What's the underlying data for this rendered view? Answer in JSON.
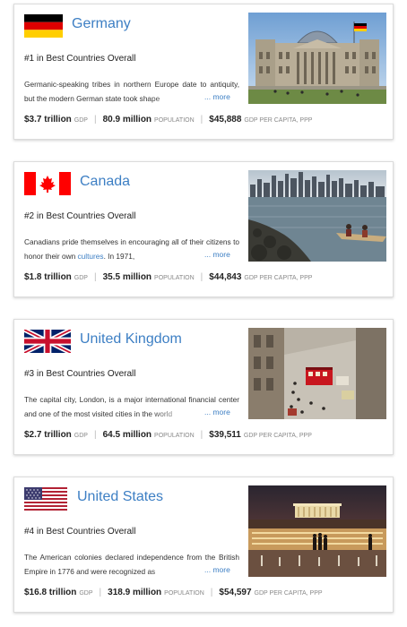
{
  "countries": [
    {
      "name": "Germany",
      "rank": "#1 in Best Countries Overall",
      "description": "Germanic-speaking tribes in northern Europe date to antiquity, but the modern German state took shape",
      "description_link": "",
      "more": "... more",
      "gdp": "$3.7 trillion",
      "gdp_label": "GDP",
      "population": "80.9 million",
      "population_label": "POPULATION",
      "gdp_per_capita": "$45,888",
      "gdp_per_capita_label": "GDP PER CAPITA, PPP"
    },
    {
      "name": "Canada",
      "rank": "#2 in Best Countries Overall",
      "description": "Canadians pride themselves in encouraging all of their citizens to honor their own ",
      "description_link": "cultures",
      "description_tail": ". In 1971,",
      "more": "... more",
      "gdp": "$1.8 trillion",
      "gdp_label": "GDP",
      "population": "35.5 million",
      "population_label": "POPULATION",
      "gdp_per_capita": "$44,843",
      "gdp_per_capita_label": "GDP PER CAPITA, PPP"
    },
    {
      "name": "United Kingdom",
      "rank": "#3 in Best Countries Overall",
      "description": "The capital city, London, is a major international financial center and one of the most visited cities in the world",
      "description_link": "",
      "more": "... more",
      "gdp": "$2.7 trillion",
      "gdp_label": "GDP",
      "population": "64.5 million",
      "population_label": "POPULATION",
      "gdp_per_capita": "$39,511",
      "gdp_per_capita_label": "GDP PER CAPITA, PPP"
    },
    {
      "name": "United States",
      "rank": "#4 in Best Countries Overall",
      "description": "The American colonies declared independence from the British Empire in 1776 and were recognized as",
      "description_link": "",
      "more": "... more",
      "gdp": "$16.8 trillion",
      "gdp_label": "GDP",
      "population": "318.9 million",
      "population_label": "POPULATION",
      "gdp_per_capita": "$54,597",
      "gdp_per_capita_label": "GDP PER CAPITA, PPP"
    }
  ],
  "colors": {
    "link_blue": "#3d7fc4",
    "germany": [
      "#000000",
      "#dd0000",
      "#ffce00"
    ],
    "canada_red": "#ff0000",
    "uk_blue": "#012169",
    "uk_red": "#c8102e",
    "us_red": "#b22234",
    "us_blue": "#3c3b6e"
  },
  "icons": [
    "flag-germany-icon",
    "flag-canada-icon",
    "flag-uk-icon",
    "flag-us-icon"
  ]
}
